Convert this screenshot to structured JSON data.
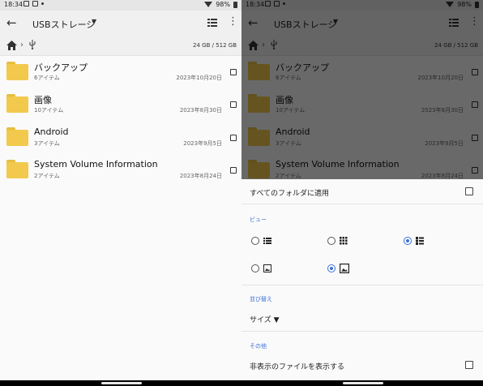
{
  "status": {
    "time": "18:34",
    "battery": "98%"
  },
  "toolbar": {
    "back_icon": "arrow-left-icon",
    "title": "USBストレージ",
    "caret": "▼",
    "view_icon": "list-view-icon",
    "more_icon": "⋮"
  },
  "pathbar": {
    "capacity": "24 GB / 512 GB"
  },
  "files": [
    {
      "name": "バックアップ",
      "count": "6アイテム",
      "date": "2023年10月20日"
    },
    {
      "name": "画像",
      "count": "10アイテム",
      "date": "2023年8月30日"
    },
    {
      "name": "Android",
      "count": "3アイテム",
      "date": "2023年9月5日"
    },
    {
      "name": "System Volume Information",
      "count": "2アイテム",
      "date": "2023年8月24日"
    }
  ],
  "sheet": {
    "apply_all": "すべてのフォルダに適用",
    "view_header": "ビュー",
    "view_options": [
      {
        "icon": "list-icon",
        "selected": false
      },
      {
        "icon": "grid-icon",
        "selected": false
      },
      {
        "icon": "list-detail-icon",
        "selected": true
      },
      {
        "icon": "thumbnail-small-icon",
        "selected": false
      },
      {
        "icon": "thumbnail-large-icon",
        "selected": true
      }
    ],
    "sort_header": "並び替え",
    "sort_value": "サイズ ▼",
    "other_header": "その他",
    "show_hidden": "非表示のファイルを表示する"
  },
  "colors": {
    "accent": "#3b6fd6",
    "folder": "#f2c94c"
  }
}
